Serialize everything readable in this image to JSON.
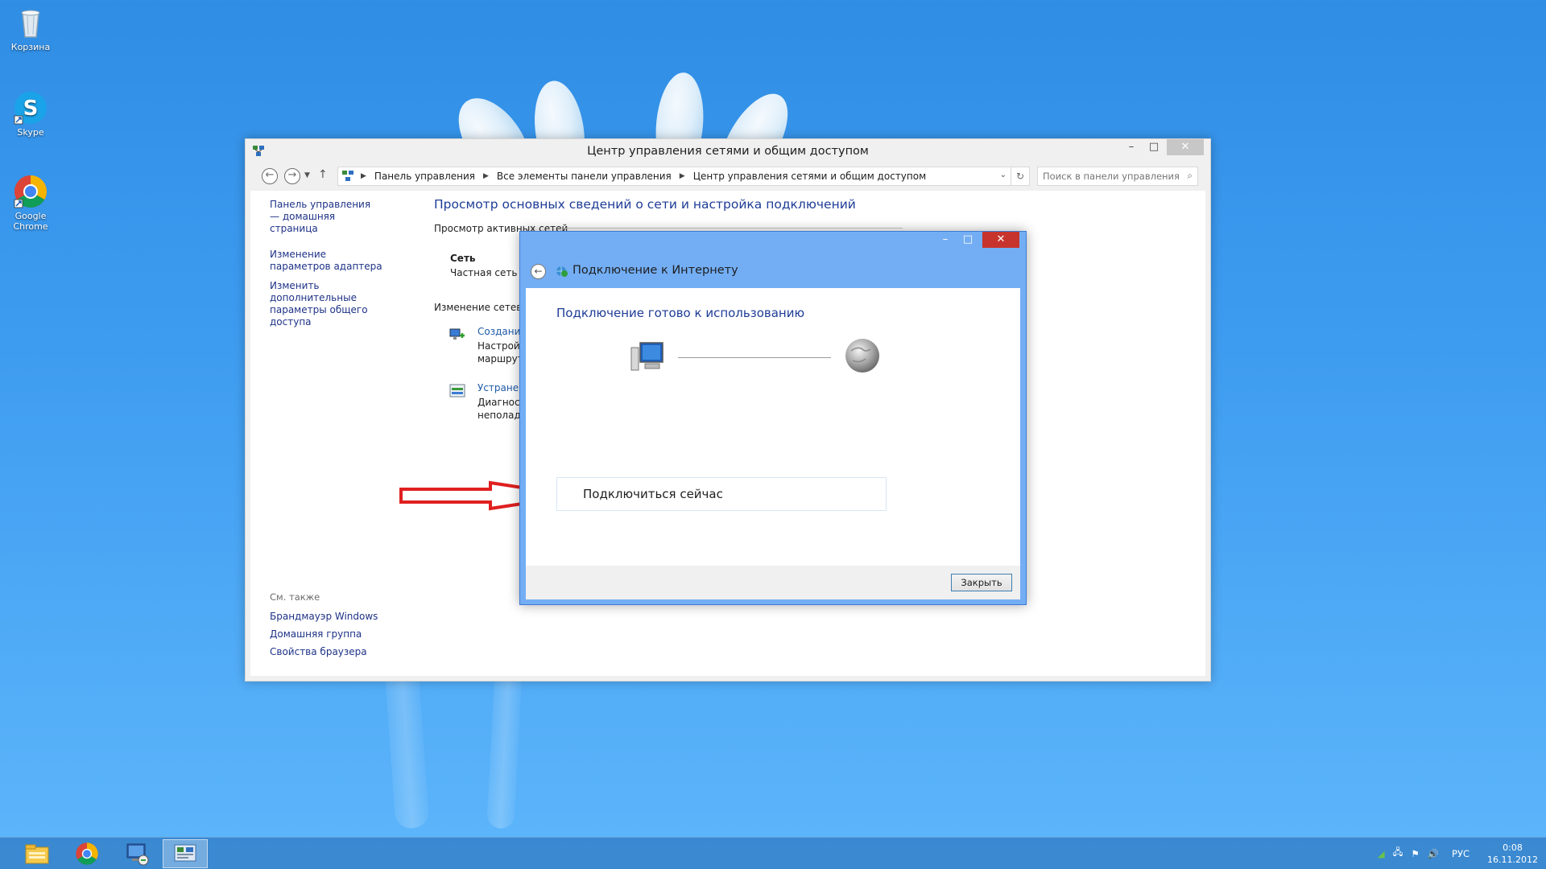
{
  "desktop": {
    "icons": [
      {
        "label": "Корзина"
      },
      {
        "label": "Skype"
      },
      {
        "label": "Google Chrome"
      }
    ]
  },
  "main_window": {
    "title": "Центр управления сетями и общим доступом",
    "address": {
      "segments": [
        "Панель управления",
        "Все элементы панели управления",
        "Центр управления сетями и общим доступом"
      ]
    },
    "search_placeholder": "Поиск в панели управления",
    "left_pane": {
      "links": [
        "Панель управления — домашняя страница",
        "Изменение параметров адаптера",
        "Изменить дополнительные параметры общего доступа"
      ],
      "see_also_heading": "См. также",
      "see_also": [
        "Брандмауэр Windows",
        "Домашняя группа",
        "Свойства браузера"
      ]
    },
    "main": {
      "title": "Просмотр основных сведений о сети и настройка подключений",
      "active_networks_label": "Просмотр активных сетей",
      "network_name": "Сеть",
      "network_type": "Частная сеть",
      "change_settings_label": "Изменение сетевых",
      "tasks": [
        {
          "link": "Создание",
          "desc1": "Настройка",
          "desc2": "маршрути"
        },
        {
          "link": "Устранени",
          "desc1": "Диагности",
          "desc2": "неполадок"
        }
      ]
    }
  },
  "dialog": {
    "title": "Подключение к Интернету",
    "status": "Подключение готово к использованию",
    "connect_now": "Подключиться сейчас",
    "close_label": "Закрыть"
  },
  "taskbar": {
    "language": "РУС",
    "time": "0:08",
    "date": "16.11.2012"
  },
  "colors": {
    "desktop_blue": "#3e9cf0",
    "dialog_frame": "#73aef4",
    "link_blue": "#1e3287",
    "heading_blue": "#1e3c96",
    "arrow_red": "#e02020"
  }
}
